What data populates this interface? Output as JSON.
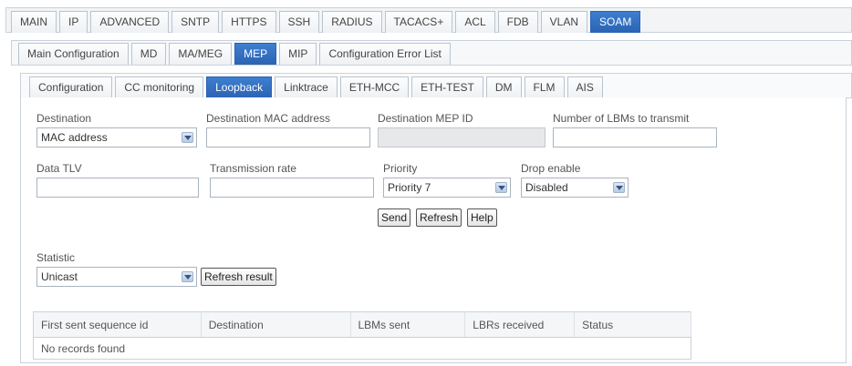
{
  "top_tabs": [
    "MAIN",
    "IP",
    "ADVANCED",
    "SNTP",
    "HTTPS",
    "SSH",
    "RADIUS",
    "TACACS+",
    "ACL",
    "FDB",
    "VLAN",
    "SOAM"
  ],
  "top_active": "SOAM",
  "sub_tabs": [
    "Main Configuration",
    "MD",
    "MA/MEG",
    "MEP",
    "MIP",
    "Configuration Error List"
  ],
  "sub_active": "MEP",
  "mep_tabs": [
    "Configuration",
    "CC monitoring",
    "Loopback",
    "Linktrace",
    "ETH-MCC",
    "ETH-TEST",
    "DM",
    "FLM",
    "AIS"
  ],
  "mep_active": "Loopback",
  "form": {
    "destination_label": "Destination",
    "destination_value": "MAC address",
    "dest_mac_label": "Destination MAC address",
    "dest_mac_value": "",
    "dest_mep_label": "Destination MEP ID",
    "dest_mep_value": "",
    "num_lbms_label": "Number of LBMs to transmit",
    "num_lbms_value": "",
    "data_tlv_label": "Data TLV",
    "data_tlv_value": "",
    "tx_rate_label": "Transmission rate",
    "tx_rate_value": "",
    "priority_label": "Priority",
    "priority_value": "Priority 7",
    "drop_label": "Drop enable",
    "drop_value": "Disabled"
  },
  "buttons": {
    "send": "Send",
    "refresh": "Refresh",
    "help": "Help",
    "refresh_result": "Refresh result"
  },
  "statistic": {
    "label": "Statistic",
    "value": "Unicast"
  },
  "table": {
    "columns": [
      "First sent sequence id",
      "Destination",
      "LBMs sent",
      "LBRs received",
      "Status"
    ],
    "empty_message": "No records found"
  }
}
